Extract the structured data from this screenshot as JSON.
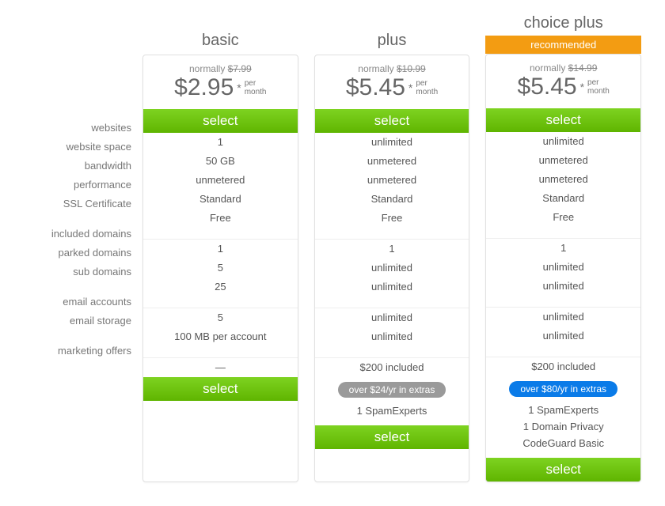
{
  "labels": {
    "group1": [
      "websites",
      "website space",
      "bandwidth",
      "performance",
      "SSL Certificate"
    ],
    "group2": [
      "included domains",
      "parked domains",
      "sub domains"
    ],
    "group3": [
      "email accounts",
      "email storage"
    ],
    "group4": [
      "marketing offers"
    ]
  },
  "common": {
    "price_prefix": "$",
    "per_word_top": "per",
    "per_word_bottom": "month",
    "select_label": "select",
    "normally_word": "normally"
  },
  "plans": {
    "basic": {
      "title": "basic",
      "normal_price": "$7.99",
      "price": "2.95",
      "features": {
        "g1": [
          "1",
          "50 GB",
          "unmetered",
          "Standard",
          "Free"
        ],
        "g2": [
          "1",
          "5",
          "25"
        ],
        "g3": [
          "5",
          "100 MB per account"
        ],
        "g4": [
          "—"
        ]
      }
    },
    "plus": {
      "title": "plus",
      "normal_price": "$10.99",
      "price": "5.45",
      "features": {
        "g1": [
          "unlimited",
          "unmetered",
          "unmetered",
          "Standard",
          "Free"
        ],
        "g2": [
          "1",
          "unlimited",
          "unlimited"
        ],
        "g3": [
          "unlimited",
          "unlimited"
        ],
        "g4": [
          "$200 included"
        ]
      },
      "extras_pill": "over $24/yr in extras",
      "extras_lines": [
        "1 SpamExperts"
      ]
    },
    "choice": {
      "title": "choice plus",
      "badge": "recommended",
      "normal_price": "$14.99",
      "price": "5.45",
      "features": {
        "g1": [
          "unlimited",
          "unmetered",
          "unmetered",
          "Standard",
          "Free"
        ],
        "g2": [
          "1",
          "unlimited",
          "unlimited"
        ],
        "g3": [
          "unlimited",
          "unlimited"
        ],
        "g4": [
          "$200 included"
        ]
      },
      "extras_pill": "over $80/yr in extras",
      "extras_lines": [
        "1 SpamExperts",
        "1 Domain Privacy",
        "CodeGuard Basic"
      ]
    }
  }
}
